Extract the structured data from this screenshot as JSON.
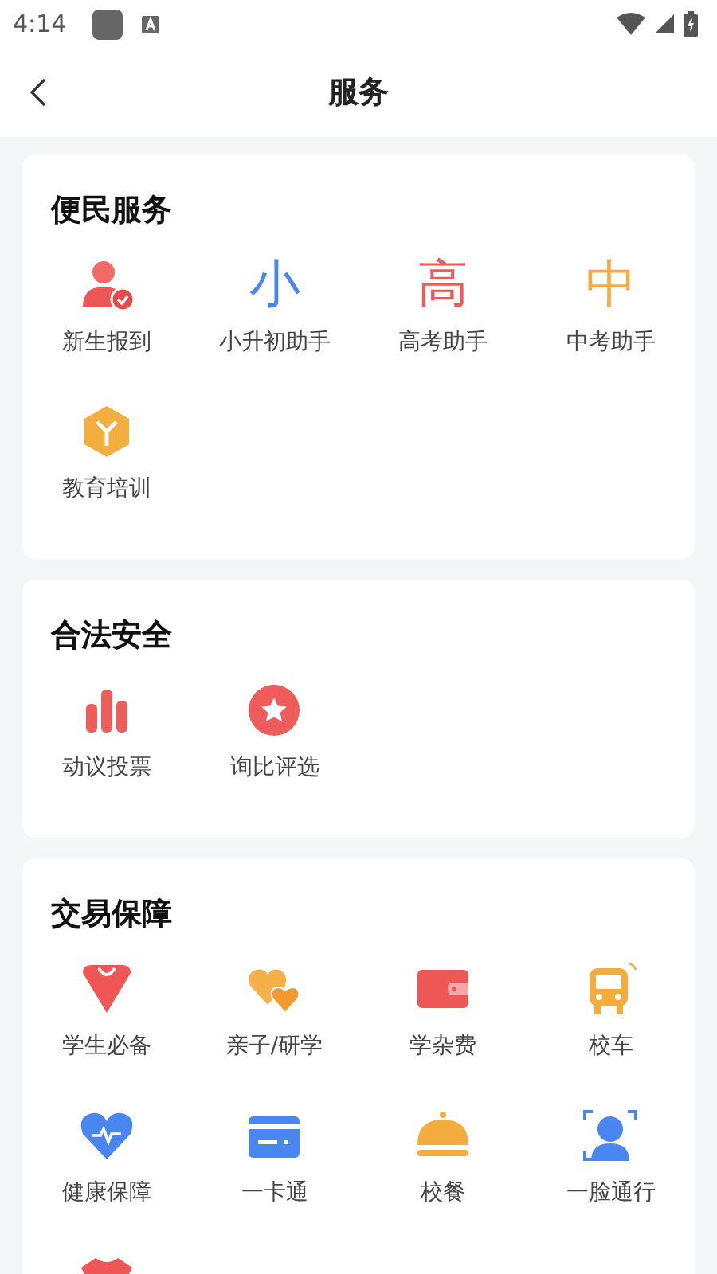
{
  "status_bar": {
    "time": "4:14"
  },
  "header": {
    "title": "服务"
  },
  "sections": [
    {
      "title": "便民服务",
      "items": [
        {
          "kind": "person",
          "label": "新生报到"
        },
        {
          "kind": "glyph",
          "glyph": "小",
          "color": "#4a86f0",
          "label": "小升初助手"
        },
        {
          "kind": "glyph",
          "glyph": "高",
          "color": "#ee5a5a",
          "label": "高考助手"
        },
        {
          "kind": "glyph",
          "glyph": "中",
          "color": "#f4ad3c",
          "label": "中考助手"
        },
        {
          "kind": "cube",
          "label": "教育培训"
        }
      ]
    },
    {
      "title": "合法安全",
      "items": [
        {
          "kind": "bars",
          "label": "动议投票"
        },
        {
          "kind": "star",
          "label": "询比评选"
        }
      ]
    },
    {
      "title": "交易保障",
      "items": [
        {
          "kind": "gem",
          "label": "学生必备"
        },
        {
          "kind": "hearts",
          "label": "亲子/研学"
        },
        {
          "kind": "wallet",
          "label": "学杂费"
        },
        {
          "kind": "bus",
          "label": "校车"
        },
        {
          "kind": "health",
          "label": "健康保障"
        },
        {
          "kind": "card",
          "label": "一卡通"
        },
        {
          "kind": "cloche",
          "label": "校餐"
        },
        {
          "kind": "face",
          "label": "一脸通行"
        },
        {
          "kind": "shirt"
        }
      ]
    }
  ]
}
